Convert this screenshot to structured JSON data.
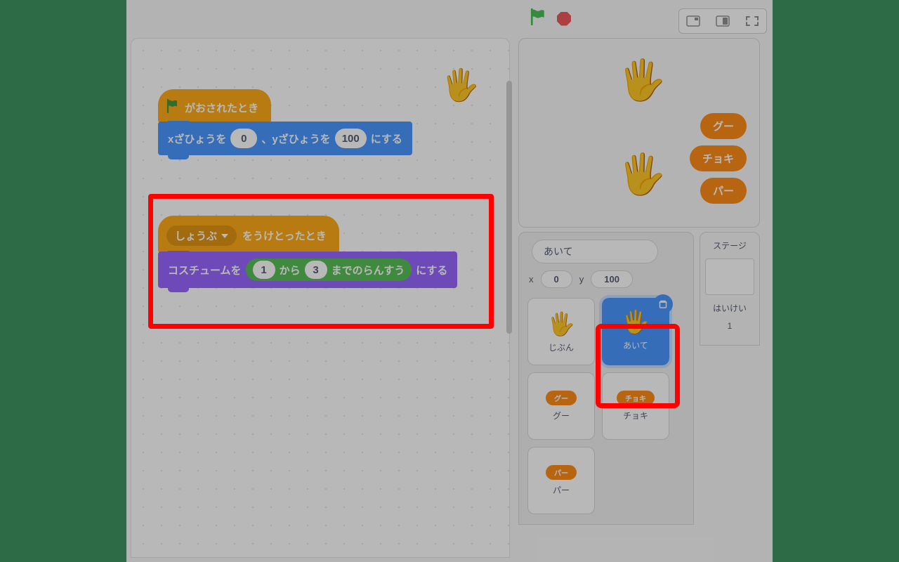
{
  "toolbar": {
    "flag_color": "#4cbf56",
    "stop_color": "#ec5959"
  },
  "script_hand_icon": "🖐️",
  "blocks": {
    "flag_hat_label": "がおされたとき",
    "motion_pre": "xざひょうを",
    "motion_x": "0",
    "motion_mid": "、yざひょうを",
    "motion_y": "100",
    "motion_post": "にする",
    "msg_name": "しょうぶ",
    "msg_hat_label": "をうけとったとき",
    "looks_pre": "コスチュームを",
    "rand_from": "1",
    "rand_mid": "から",
    "rand_to": "3",
    "rand_post": "までのらんすう",
    "looks_post": "にする"
  },
  "stage": {
    "btn_gu": "グー",
    "btn_choki": "チョキ",
    "btn_pa": "パー"
  },
  "sprite_info": {
    "name": "あいて",
    "x_label": "x",
    "x_val": "0",
    "y_label": "y",
    "y_val": "100"
  },
  "sprites": {
    "jibun": "じぶん",
    "aite": "あいて",
    "gu": "グー",
    "choki": "チョキ",
    "pa": "パー"
  },
  "stage_col": {
    "title": "ステージ",
    "backdrops_label": "はいけい",
    "backdrops_count": "1"
  }
}
